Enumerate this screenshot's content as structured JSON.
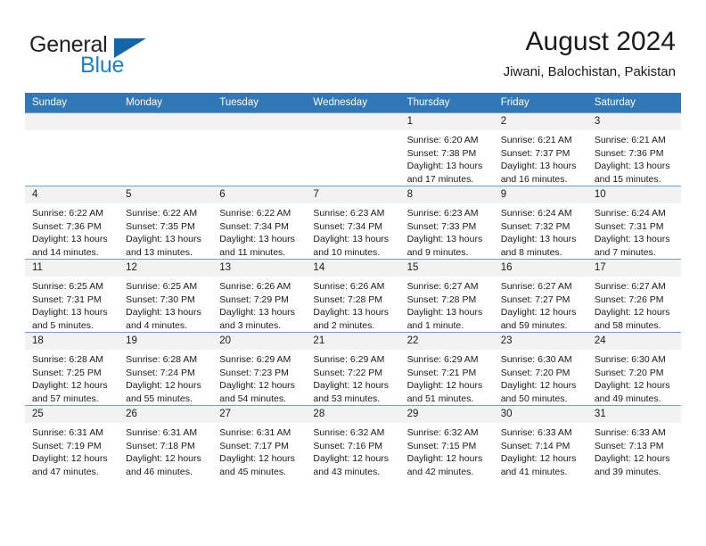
{
  "logo": {
    "word_primary": "General",
    "word_secondary": "Blue",
    "triangle_color": "#1565a8",
    "secondary_color": "#1f7fc4"
  },
  "header": {
    "title": "August 2024",
    "subtitle": "Jiwani, Balochistan, Pakistan"
  },
  "theme": {
    "header_row_bg": "#3277b7",
    "header_row_text": "#ffffff",
    "daynum_bg": "#f2f2f2",
    "grid_line": "#6f9fcc"
  },
  "weekday_headers": [
    "Sunday",
    "Monday",
    "Tuesday",
    "Wednesday",
    "Thursday",
    "Friday",
    "Saturday"
  ],
  "weeks": [
    [
      {
        "day": "",
        "empty": true
      },
      {
        "day": "",
        "empty": true
      },
      {
        "day": "",
        "empty": true
      },
      {
        "day": "",
        "empty": true
      },
      {
        "day": "1",
        "sunrise": "Sunrise: 6:20 AM",
        "sunset": "Sunset: 7:38 PM",
        "daylight1": "Daylight: 13 hours",
        "daylight2": "and 17 minutes."
      },
      {
        "day": "2",
        "sunrise": "Sunrise: 6:21 AM",
        "sunset": "Sunset: 7:37 PM",
        "daylight1": "Daylight: 13 hours",
        "daylight2": "and 16 minutes."
      },
      {
        "day": "3",
        "sunrise": "Sunrise: 6:21 AM",
        "sunset": "Sunset: 7:36 PM",
        "daylight1": "Daylight: 13 hours",
        "daylight2": "and 15 minutes."
      }
    ],
    [
      {
        "day": "4",
        "sunrise": "Sunrise: 6:22 AM",
        "sunset": "Sunset: 7:36 PM",
        "daylight1": "Daylight: 13 hours",
        "daylight2": "and 14 minutes."
      },
      {
        "day": "5",
        "sunrise": "Sunrise: 6:22 AM",
        "sunset": "Sunset: 7:35 PM",
        "daylight1": "Daylight: 13 hours",
        "daylight2": "and 13 minutes."
      },
      {
        "day": "6",
        "sunrise": "Sunrise: 6:22 AM",
        "sunset": "Sunset: 7:34 PM",
        "daylight1": "Daylight: 13 hours",
        "daylight2": "and 11 minutes."
      },
      {
        "day": "7",
        "sunrise": "Sunrise: 6:23 AM",
        "sunset": "Sunset: 7:34 PM",
        "daylight1": "Daylight: 13 hours",
        "daylight2": "and 10 minutes."
      },
      {
        "day": "8",
        "sunrise": "Sunrise: 6:23 AM",
        "sunset": "Sunset: 7:33 PM",
        "daylight1": "Daylight: 13 hours",
        "daylight2": "and 9 minutes."
      },
      {
        "day": "9",
        "sunrise": "Sunrise: 6:24 AM",
        "sunset": "Sunset: 7:32 PM",
        "daylight1": "Daylight: 13 hours",
        "daylight2": "and 8 minutes."
      },
      {
        "day": "10",
        "sunrise": "Sunrise: 6:24 AM",
        "sunset": "Sunset: 7:31 PM",
        "daylight1": "Daylight: 13 hours",
        "daylight2": "and 7 minutes."
      }
    ],
    [
      {
        "day": "11",
        "sunrise": "Sunrise: 6:25 AM",
        "sunset": "Sunset: 7:31 PM",
        "daylight1": "Daylight: 13 hours",
        "daylight2": "and 5 minutes."
      },
      {
        "day": "12",
        "sunrise": "Sunrise: 6:25 AM",
        "sunset": "Sunset: 7:30 PM",
        "daylight1": "Daylight: 13 hours",
        "daylight2": "and 4 minutes."
      },
      {
        "day": "13",
        "sunrise": "Sunrise: 6:26 AM",
        "sunset": "Sunset: 7:29 PM",
        "daylight1": "Daylight: 13 hours",
        "daylight2": "and 3 minutes."
      },
      {
        "day": "14",
        "sunrise": "Sunrise: 6:26 AM",
        "sunset": "Sunset: 7:28 PM",
        "daylight1": "Daylight: 13 hours",
        "daylight2": "and 2 minutes."
      },
      {
        "day": "15",
        "sunrise": "Sunrise: 6:27 AM",
        "sunset": "Sunset: 7:28 PM",
        "daylight1": "Daylight: 13 hours",
        "daylight2": "and 1 minute."
      },
      {
        "day": "16",
        "sunrise": "Sunrise: 6:27 AM",
        "sunset": "Sunset: 7:27 PM",
        "daylight1": "Daylight: 12 hours",
        "daylight2": "and 59 minutes."
      },
      {
        "day": "17",
        "sunrise": "Sunrise: 6:27 AM",
        "sunset": "Sunset: 7:26 PM",
        "daylight1": "Daylight: 12 hours",
        "daylight2": "and 58 minutes."
      }
    ],
    [
      {
        "day": "18",
        "sunrise": "Sunrise: 6:28 AM",
        "sunset": "Sunset: 7:25 PM",
        "daylight1": "Daylight: 12 hours",
        "daylight2": "and 57 minutes."
      },
      {
        "day": "19",
        "sunrise": "Sunrise: 6:28 AM",
        "sunset": "Sunset: 7:24 PM",
        "daylight1": "Daylight: 12 hours",
        "daylight2": "and 55 minutes."
      },
      {
        "day": "20",
        "sunrise": "Sunrise: 6:29 AM",
        "sunset": "Sunset: 7:23 PM",
        "daylight1": "Daylight: 12 hours",
        "daylight2": "and 54 minutes."
      },
      {
        "day": "21",
        "sunrise": "Sunrise: 6:29 AM",
        "sunset": "Sunset: 7:22 PM",
        "daylight1": "Daylight: 12 hours",
        "daylight2": "and 53 minutes."
      },
      {
        "day": "22",
        "sunrise": "Sunrise: 6:29 AM",
        "sunset": "Sunset: 7:21 PM",
        "daylight1": "Daylight: 12 hours",
        "daylight2": "and 51 minutes."
      },
      {
        "day": "23",
        "sunrise": "Sunrise: 6:30 AM",
        "sunset": "Sunset: 7:20 PM",
        "daylight1": "Daylight: 12 hours",
        "daylight2": "and 50 minutes."
      },
      {
        "day": "24",
        "sunrise": "Sunrise: 6:30 AM",
        "sunset": "Sunset: 7:20 PM",
        "daylight1": "Daylight: 12 hours",
        "daylight2": "and 49 minutes."
      }
    ],
    [
      {
        "day": "25",
        "sunrise": "Sunrise: 6:31 AM",
        "sunset": "Sunset: 7:19 PM",
        "daylight1": "Daylight: 12 hours",
        "daylight2": "and 47 minutes."
      },
      {
        "day": "26",
        "sunrise": "Sunrise: 6:31 AM",
        "sunset": "Sunset: 7:18 PM",
        "daylight1": "Daylight: 12 hours",
        "daylight2": "and 46 minutes."
      },
      {
        "day": "27",
        "sunrise": "Sunrise: 6:31 AM",
        "sunset": "Sunset: 7:17 PM",
        "daylight1": "Daylight: 12 hours",
        "daylight2": "and 45 minutes."
      },
      {
        "day": "28",
        "sunrise": "Sunrise: 6:32 AM",
        "sunset": "Sunset: 7:16 PM",
        "daylight1": "Daylight: 12 hours",
        "daylight2": "and 43 minutes."
      },
      {
        "day": "29",
        "sunrise": "Sunrise: 6:32 AM",
        "sunset": "Sunset: 7:15 PM",
        "daylight1": "Daylight: 12 hours",
        "daylight2": "and 42 minutes."
      },
      {
        "day": "30",
        "sunrise": "Sunrise: 6:33 AM",
        "sunset": "Sunset: 7:14 PM",
        "daylight1": "Daylight: 12 hours",
        "daylight2": "and 41 minutes."
      },
      {
        "day": "31",
        "sunrise": "Sunrise: 6:33 AM",
        "sunset": "Sunset: 7:13 PM",
        "daylight1": "Daylight: 12 hours",
        "daylight2": "and 39 minutes."
      }
    ]
  ]
}
